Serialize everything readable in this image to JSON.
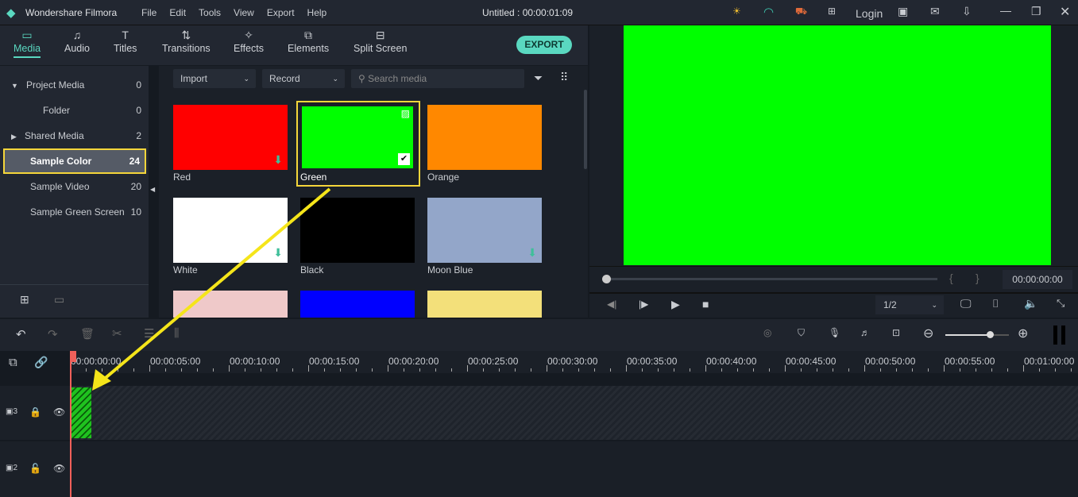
{
  "app": {
    "title": "Wondershare Filmora",
    "project": "Untitled : 00:00:01:09",
    "login": "Login"
  },
  "menu": [
    "File",
    "Edit",
    "Tools",
    "View",
    "Export",
    "Help"
  ],
  "tabs": [
    {
      "label": "Media",
      "icon": "folder-icon"
    },
    {
      "label": "Audio",
      "icon": "music-icon"
    },
    {
      "label": "Titles",
      "icon": "text-icon"
    },
    {
      "label": "Transitions",
      "icon": "transition-icon"
    },
    {
      "label": "Effects",
      "icon": "effects-icon"
    },
    {
      "label": "Elements",
      "icon": "elements-icon"
    },
    {
      "label": "Split Screen",
      "icon": "split-screen-icon"
    }
  ],
  "export_label": "EXPORT",
  "sidebar": [
    {
      "label": "Project Media",
      "count": "0"
    },
    {
      "label": "Folder",
      "count": "0"
    },
    {
      "label": "Shared Media",
      "count": "2"
    },
    {
      "label": "Sample Color",
      "count": "24"
    },
    {
      "label": "Sample Video",
      "count": "20"
    },
    {
      "label": "Sample Green Screen",
      "count": "10"
    }
  ],
  "media_toolbar": {
    "import": "Import",
    "record": "Record",
    "search_placeholder": "Search media"
  },
  "media": [
    {
      "name": "Red",
      "color": "#ff0000"
    },
    {
      "name": "Green",
      "color": "#00ff00"
    },
    {
      "name": "Orange",
      "color": "#ff8800"
    },
    {
      "name": "White",
      "color": "#ffffff"
    },
    {
      "name": "Black",
      "color": "#000000"
    },
    {
      "name": "Moon Blue",
      "color": "#93a6c9"
    },
    {
      "name": "",
      "color": "#efc9c9"
    },
    {
      "name": "",
      "color": "#0000ff"
    },
    {
      "name": "",
      "color": "#f3e07a"
    }
  ],
  "preview": {
    "timecode": "00:00:00:00",
    "quality": "1/2",
    "color": "#00ff00"
  },
  "timeline": {
    "ruler": [
      "00:00:00:00",
      "00:00:05:00",
      "00:00:10:00",
      "00:00:15:00",
      "00:00:20:00",
      "00:00:25:00",
      "00:00:30:00",
      "00:00:35:00",
      "00:00:40:00",
      "00:00:45:00",
      "00:00:50:00",
      "00:00:55:00",
      "00:01:00:00"
    ],
    "tracks": [
      "3",
      "2"
    ],
    "zoom_level": 0.7
  },
  "colors": {
    "accent": "#5ad8c0",
    "highlight": "#f5d63a",
    "playhead": "#f0605a"
  }
}
